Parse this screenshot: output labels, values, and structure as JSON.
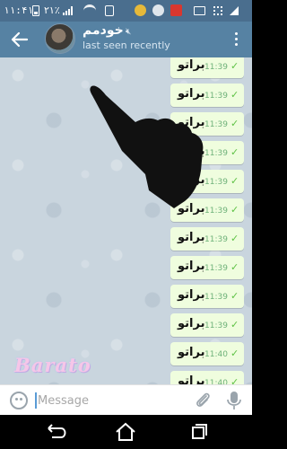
{
  "status_bar": {
    "time": "۱۱:۴۱",
    "battery_percent": "۲۱٪",
    "colors": {
      "background": "#4a6e8e"
    }
  },
  "header": {
    "title": "خودمم",
    "subtitle": "last seen recently",
    "back_icon": "arrow-left-icon",
    "menu_icon": "more-vertical-icon",
    "mute_icon": "mute-icon",
    "colors": {
      "background": "#5682a3"
    }
  },
  "messages": [
    {
      "text": "براتو",
      "time": "11:39",
      "status": "check-icon"
    },
    {
      "text": "براتو",
      "time": "11:39",
      "status": "check-icon"
    },
    {
      "text": "براتو",
      "time": "11:39",
      "status": "check-icon"
    },
    {
      "text": "براتو",
      "time": "11:39",
      "status": "check-icon"
    },
    {
      "text": "براتو",
      "time": "11:39",
      "status": "check-icon"
    },
    {
      "text": "براتو",
      "time": "11:39",
      "status": "check-icon"
    },
    {
      "text": "براتو",
      "time": "11:39",
      "status": "check-icon"
    },
    {
      "text": "براتو",
      "time": "11:39",
      "status": "check-icon"
    },
    {
      "text": "براتو",
      "time": "11:39",
      "status": "check-icon"
    },
    {
      "text": "براتو",
      "time": "11:39",
      "status": "check-icon"
    },
    {
      "text": "براتو",
      "time": "11:40",
      "status": "check-icon"
    },
    {
      "text": "براتو",
      "time": "11:40",
      "status": "check-icon"
    }
  ],
  "watermark": "Barato",
  "composer": {
    "placeholder": "Message",
    "emoji_icon": "emoji-icon",
    "attach_icon": "paperclip-icon",
    "mic_icon": "microphone-icon"
  },
  "nav": {
    "back_icon": "back-icon",
    "home_icon": "home-icon",
    "recents_icon": "recents-icon"
  }
}
